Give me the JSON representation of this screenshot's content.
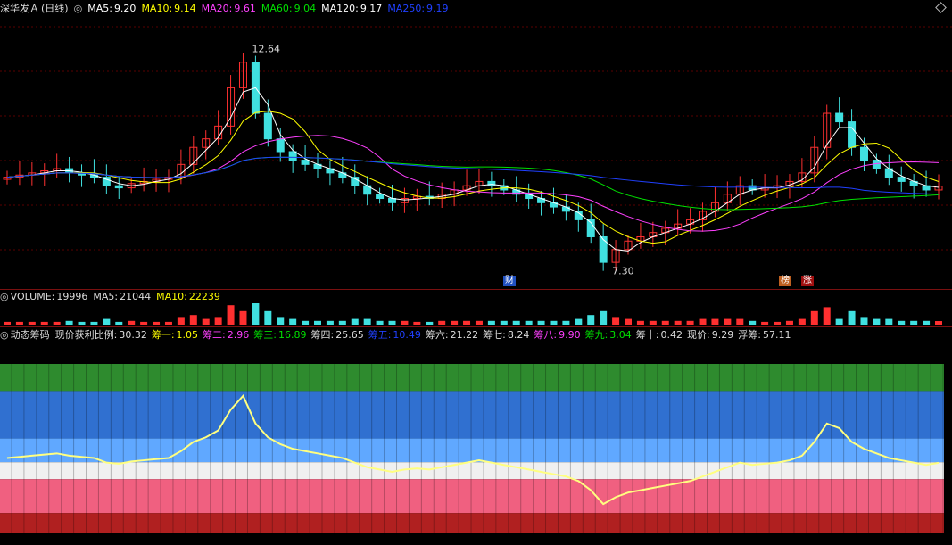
{
  "price_panel": {
    "stock_name": "深华发Ａ",
    "period": "(日线)",
    "ma": [
      {
        "label": "MA5:",
        "value": "9.20",
        "color": "#ffffff"
      },
      {
        "label": "MA10:",
        "value": "9.14",
        "color": "#ffff00"
      },
      {
        "label": "MA20:",
        "value": "9.61",
        "color": "#ff40ff"
      },
      {
        "label": "MA60:",
        "value": "9.04",
        "color": "#00e000"
      },
      {
        "label": "MA120:",
        "value": "9.17",
        "color": "#ffffff"
      },
      {
        "label": "MA250:",
        "value": "9.19",
        "color": "#2040ff"
      }
    ],
    "high_label": "12.64",
    "low_label": "7.30",
    "tags": [
      "财",
      "榜",
      "涨"
    ]
  },
  "volume_panel": {
    "label": "VOLUME:",
    "value": "19996",
    "ma5_label": "MA5:",
    "ma5_value": "21044",
    "ma10_label": "MA10:",
    "ma10_value": "22239"
  },
  "chip_panel": {
    "title": "动态筹码",
    "items": [
      {
        "label": "现价获利比例:",
        "value": "30.32",
        "color": "#dddddd"
      },
      {
        "label": "筹一:",
        "value": "1.05",
        "color": "#ffff00"
      },
      {
        "label": "筹二:",
        "value": "2.96",
        "color": "#ff40ff"
      },
      {
        "label": "筹三:",
        "value": "16.89",
        "color": "#00e000"
      },
      {
        "label": "筹四:",
        "value": "25.65",
        "color": "#dddddd"
      },
      {
        "label": "筹五:",
        "value": "10.49",
        "color": "#2040ff"
      },
      {
        "label": "筹六:",
        "value": "21.22",
        "color": "#dddddd"
      },
      {
        "label": "筹七:",
        "value": "8.24",
        "color": "#dddddd"
      },
      {
        "label": "筹八:",
        "value": "9.90",
        "color": "#ff40ff"
      },
      {
        "label": "筹九:",
        "value": "3.04",
        "color": "#00e000"
      },
      {
        "label": "筹十:",
        "value": "0.42",
        "color": "#dddddd"
      },
      {
        "label": "现价:",
        "value": "9.29",
        "color": "#dddddd"
      },
      {
        "label": "浮筹:",
        "value": "57.11",
        "color": "#dddddd"
      }
    ]
  },
  "chart_data": {
    "type": "candlestick",
    "price_range": [
      7.0,
      13.2
    ],
    "high": 12.64,
    "low": 7.3,
    "last_close": 9.29,
    "close_series": [
      9.5,
      9.55,
      9.6,
      9.65,
      9.7,
      9.6,
      9.55,
      9.5,
      9.3,
      9.25,
      9.35,
      9.4,
      9.45,
      9.5,
      9.8,
      10.2,
      10.4,
      10.7,
      11.6,
      12.2,
      11.0,
      10.4,
      10.1,
      9.9,
      9.8,
      9.7,
      9.6,
      9.5,
      9.3,
      9.1,
      9.0,
      8.9,
      9.0,
      9.05,
      9.0,
      9.1,
      9.2,
      9.3,
      9.4,
      9.3,
      9.2,
      9.1,
      9.0,
      8.9,
      8.8,
      8.7,
      8.5,
      8.1,
      7.5,
      7.8,
      8.0,
      8.1,
      8.2,
      8.3,
      8.4,
      8.5,
      8.7,
      8.9,
      9.1,
      9.3,
      9.2,
      9.25,
      9.3,
      9.4,
      9.6,
      10.2,
      11.0,
      10.8,
      10.2,
      9.9,
      9.7,
      9.5,
      9.4,
      9.3,
      9.2,
      9.29
    ],
    "volume_summary": {
      "volume": 19996,
      "ma5": 21044,
      "ma10": 22239
    }
  }
}
